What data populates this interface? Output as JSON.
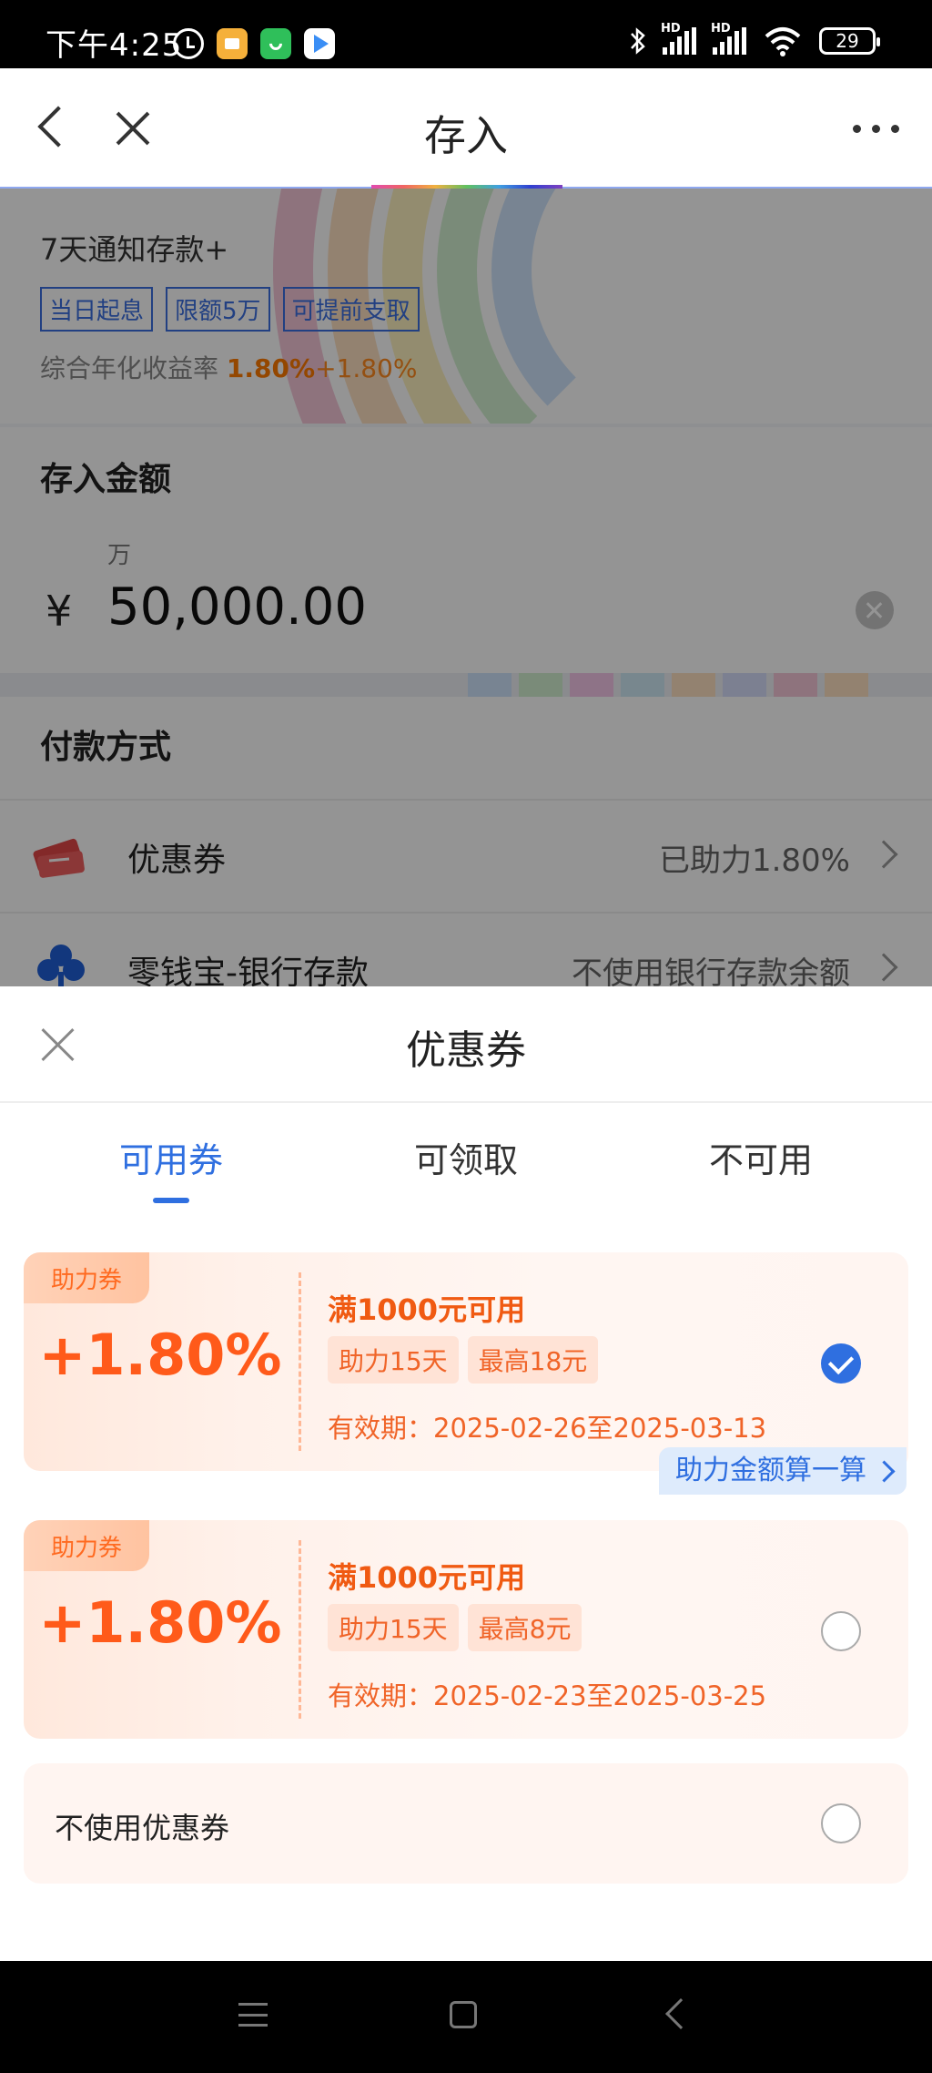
{
  "status_bar": {
    "time": "下午4:25",
    "battery": "29",
    "hd1": "HD",
    "hd2": "HD"
  },
  "nav": {
    "title": "存入"
  },
  "product": {
    "name": "7天通知存款+",
    "tags": [
      "当日起息",
      "限额5万",
      "可提前支取"
    ],
    "rate_label": "综合年化收益率",
    "rate_base": "1.80%",
    "rate_bonus": "+1.80%"
  },
  "amount": {
    "label": "存入金额",
    "unit": "万",
    "currency": "¥",
    "value": "50,000.00"
  },
  "payment": {
    "label": "付款方式",
    "rows": [
      {
        "name": "优惠券",
        "value": "已助力1.80%",
        "icon": "coupon-icon"
      },
      {
        "name": "零钱宝-银行存款",
        "value": "不使用银行存款余额",
        "icon": "clover-icon"
      }
    ]
  },
  "sheet": {
    "title": "优惠券",
    "tabs": [
      "可用券",
      "可领取",
      "不可用"
    ],
    "active_tab": "可用券",
    "coupons": [
      {
        "badge": "助力券",
        "percent": "+1.80%",
        "condition": "满1000元可用",
        "chips": [
          "助力15天",
          "最高18元"
        ],
        "valid": "有效期：2025-02-26至2025-03-13",
        "selected": true
      },
      {
        "badge": "助力券",
        "percent": "+1.80%",
        "condition": "满1000元可用",
        "chips": [
          "助力15天",
          "最高8元"
        ],
        "valid": "有效期：2025-02-23至2025-03-25",
        "selected": false
      }
    ],
    "calc_link": "助力金额算一算",
    "no_coupon": "不使用优惠券"
  },
  "colors": {
    "accent": "#2f6fe0",
    "coupon_orange": "#ff5a1a",
    "rate_orange": "#ff7a00"
  }
}
